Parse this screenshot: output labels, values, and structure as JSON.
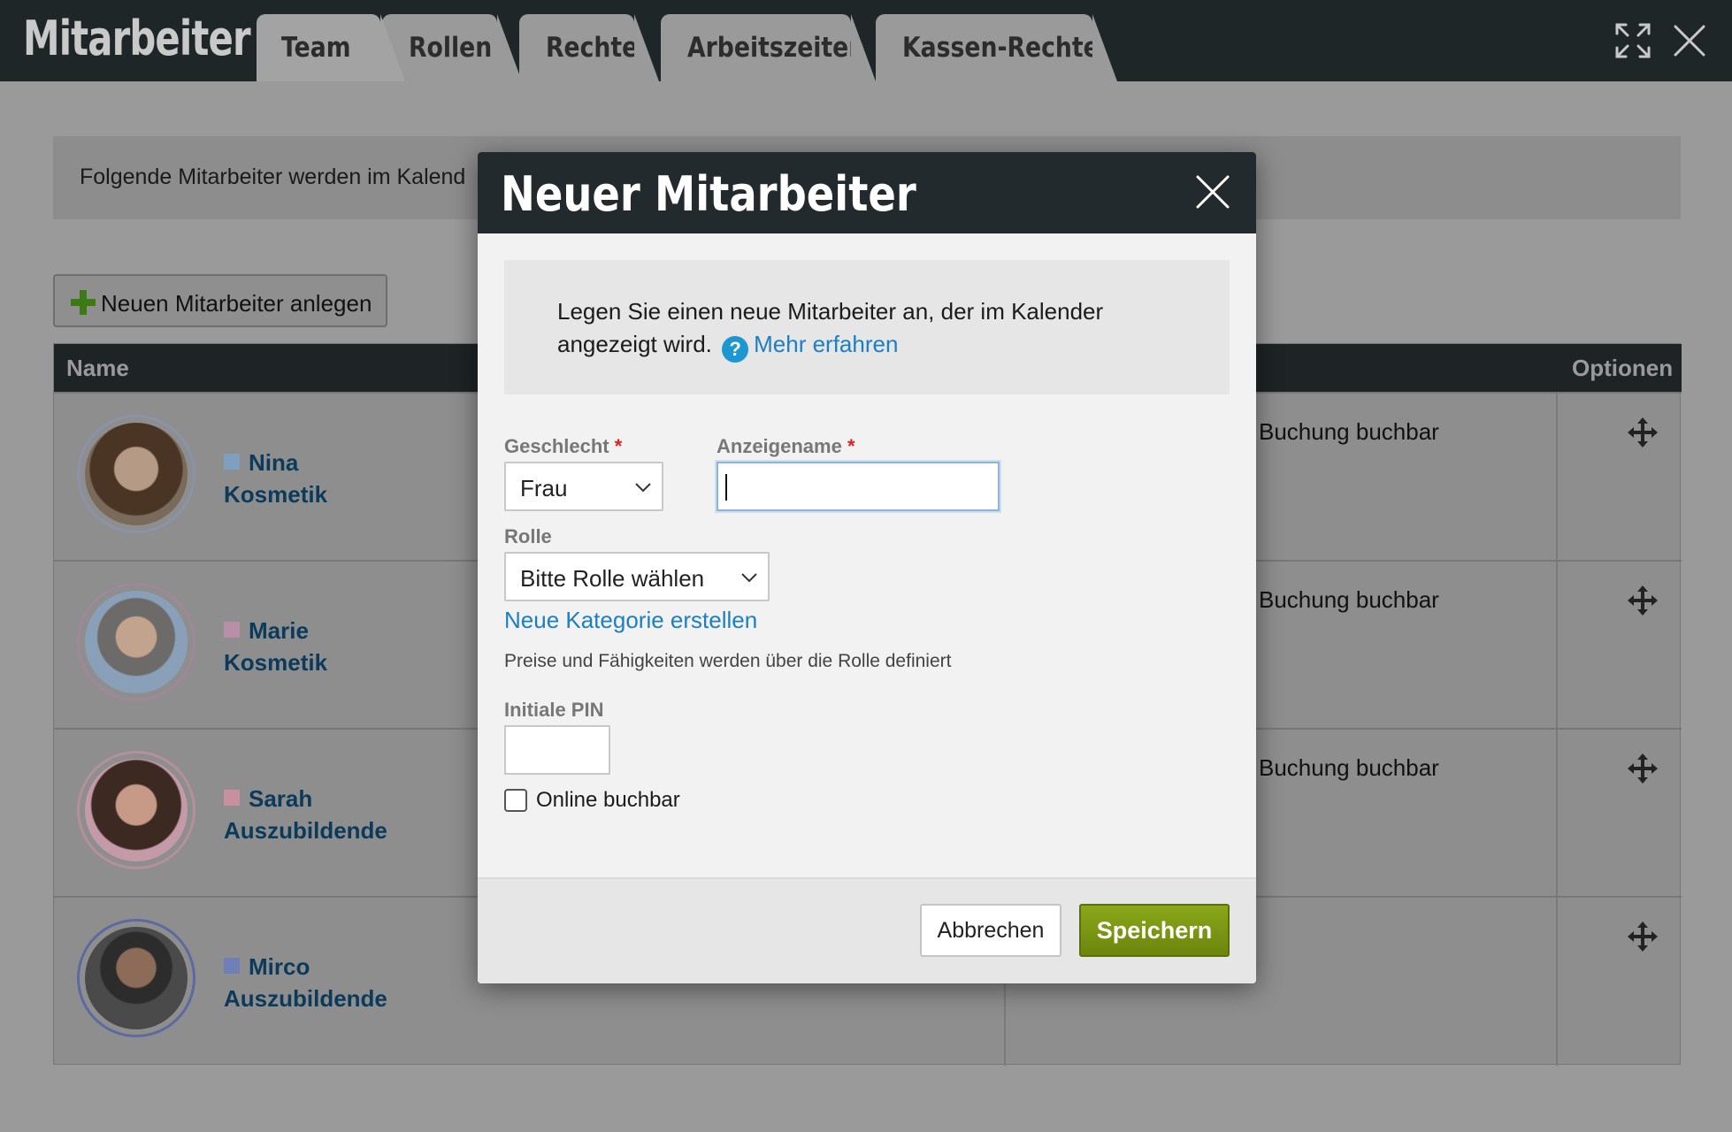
{
  "app": {
    "title": "Mitarbeiter",
    "tabs": [
      {
        "label": "Team",
        "active": true
      },
      {
        "label": "Rollen",
        "active": false
      },
      {
        "label": "Rechte",
        "active": false
      },
      {
        "label": "Arbeitszeiten",
        "active": false
      },
      {
        "label": "Kassen-Rechte",
        "active": false
      }
    ],
    "icons": {
      "expand": "expand-icon",
      "close": "close-icon"
    }
  },
  "page": {
    "info_text": "Folgende Mitarbeiter werden im Kalend",
    "add_button_label": "Neuen Mitarbeiter anlegen",
    "table": {
      "headers": {
        "name": "Name",
        "options": "Optionen"
      },
      "rows": [
        {
          "first": "Nina",
          "role": "Kosmetik",
          "color": "#7f9fc0",
          "buchung": "Buchung buchbar"
        },
        {
          "first": "Marie",
          "role": "Kosmetik",
          "color": "#b88fa8",
          "buchung": "Buchung buchbar"
        },
        {
          "first": "Sarah",
          "role": "Auszubildende",
          "color": "#c88fa0",
          "buchung": "Buchung buchbar"
        },
        {
          "first": "Mirco",
          "role": "Auszubildende",
          "color": "#6f7fb8",
          "buchung": ""
        }
      ]
    }
  },
  "modal": {
    "title": "Neuer Mitarbeiter",
    "intro_text": "Legen Sie einen neue Mitarbeiter an, der im Kalender angezeigt wird.",
    "more_link": "Mehr erfahren",
    "fields": {
      "gender_label": "Geschlecht",
      "gender_value": "Frau",
      "display_name_label": "Anzeigename",
      "display_name_value": "",
      "role_label": "Rolle",
      "role_value": "Bitte Rolle wählen",
      "required_marker": "*"
    },
    "new_category_link": "Neue Kategorie erstellen",
    "hint": "Preise und Fähigkeiten werden über die Rolle definiert",
    "pin_label": "Initiale PIN",
    "pin_value": "",
    "online_label": "Online buchbar",
    "online_checked": false,
    "cancel_label": "Abbrechen",
    "save_label": "Speichern",
    "colors": {
      "accent_link": "#1b7fc2",
      "save_button": "#7a9614",
      "help_icon": "#1d96d1"
    }
  }
}
